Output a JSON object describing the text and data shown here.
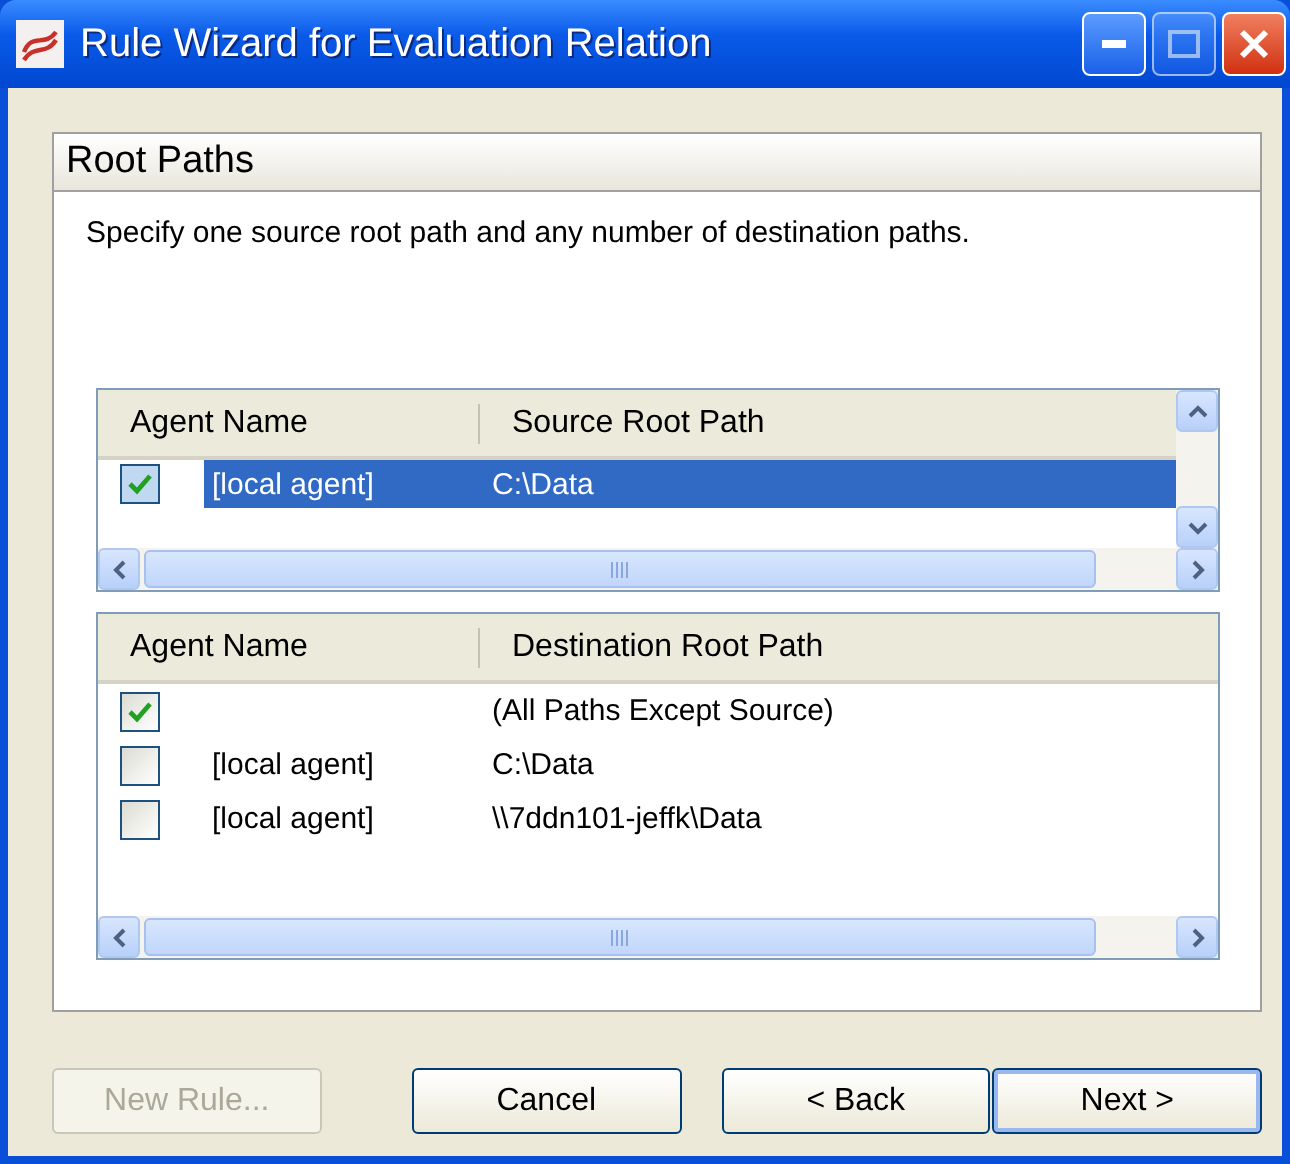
{
  "window": {
    "title": "Rule Wizard for Evaluation Relation"
  },
  "page": {
    "title": "Root Paths",
    "instruction": "Specify one source root path and any number of destination paths."
  },
  "source_list": {
    "columns": [
      "Agent Name",
      "Source Root Path"
    ],
    "rows": [
      {
        "checked": true,
        "selected": true,
        "agent": "[local agent]",
        "path": "C:\\Data"
      }
    ]
  },
  "destination_list": {
    "columns": [
      "Agent Name",
      "Destination Root Path"
    ],
    "rows": [
      {
        "checked": true,
        "selected": false,
        "agent": "",
        "path": "(All Paths Except Source)"
      },
      {
        "checked": false,
        "selected": false,
        "agent": "[local agent]",
        "path": "C:\\Data"
      },
      {
        "checked": false,
        "selected": false,
        "agent": "[local agent]",
        "path": "\\\\7ddn101-jeffk\\Data"
      }
    ]
  },
  "buttons": [
    {
      "label": "New Rule...",
      "disabled": true,
      "default": false
    },
    {
      "label": "Cancel",
      "disabled": false,
      "default": false
    },
    {
      "label": "< Back",
      "disabled": false,
      "default": false
    },
    {
      "label": "Next >",
      "disabled": false,
      "default": true
    }
  ]
}
